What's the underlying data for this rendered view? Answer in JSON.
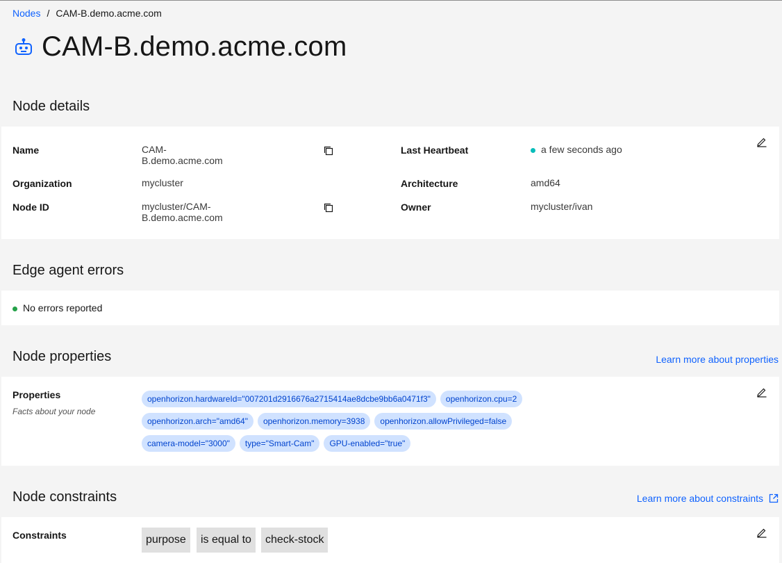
{
  "breadcrumb": {
    "parent": "Nodes",
    "separator": "/",
    "current": "CAM-B.demo.acme.com"
  },
  "page": {
    "title": "CAM-B.demo.acme.com",
    "icon": "robot-icon"
  },
  "node_details": {
    "title": "Node details",
    "name_label": "Name",
    "name_value_line1": "CAM-",
    "name_value_line2": "B.demo.acme.com",
    "org_label": "Organization",
    "org_value": "mycluster",
    "nodeid_label": "Node ID",
    "nodeid_value_line1": "mycluster/CAM-",
    "nodeid_value_line2": "B.demo.acme.com",
    "heartbeat_label": "Last Heartbeat",
    "heartbeat_value": "a few seconds ago",
    "arch_label": "Architecture",
    "arch_value": "amd64",
    "owner_label": "Owner",
    "owner_value": "mycluster/ivan"
  },
  "edge_errors": {
    "title": "Edge agent errors",
    "status": "No errors reported"
  },
  "node_properties": {
    "title": "Node properties",
    "learn_more": "Learn more about properties",
    "label": "Properties",
    "sublabel": "Facts about your node",
    "tags": [
      "openhorizon.hardwareId=\"007201d2916676a2715414ae8dcbe9bb6a0471f3\"",
      "openhorizon.cpu=2",
      "openhorizon.arch=\"amd64\"",
      "openhorizon.memory=3938",
      "openhorizon.allowPrivileged=false",
      "camera-model=\"3000\"",
      "type=\"Smart-Cam\"",
      "GPU-enabled=\"true\""
    ]
  },
  "node_constraints": {
    "title": "Node constraints",
    "learn_more": "Learn more about constraints",
    "label": "Constraints",
    "property": "purpose",
    "operator": "is equal to",
    "value": "check-stock"
  },
  "colors": {
    "accent": "#0f62fe",
    "heartbeat_dot": "#08bdba",
    "ok_dot": "#24a148",
    "tag_bg": "#d0e2ff",
    "tag_text": "#0043ce"
  }
}
